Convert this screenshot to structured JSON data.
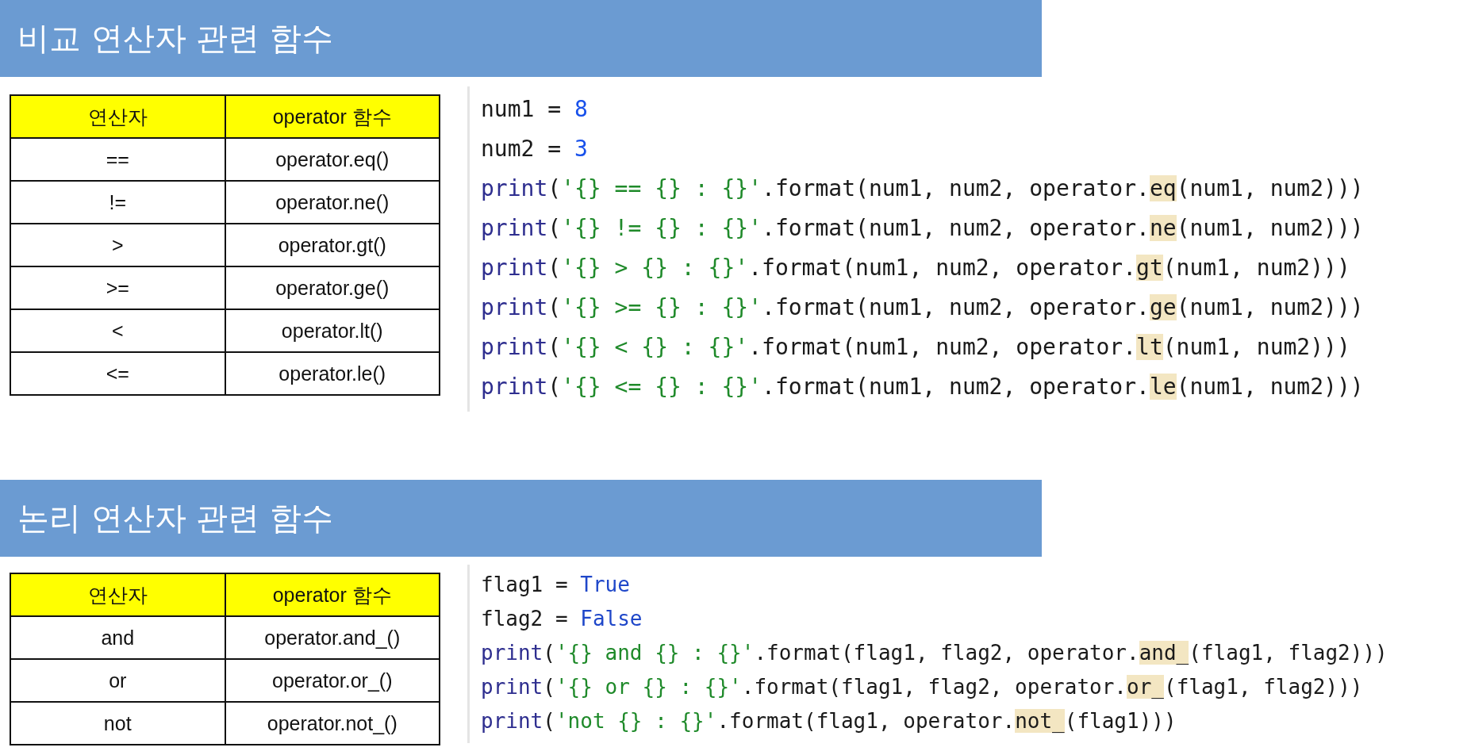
{
  "sections": [
    {
      "title": "비교 연산자 관련 함수",
      "kind": "wide",
      "table": {
        "columns": [
          "연산자",
          "operator 함수"
        ],
        "rows": [
          [
            "==",
            "operator.eq()"
          ],
          [
            "!=",
            "operator.ne()"
          ],
          [
            ">",
            "operator.gt()"
          ],
          [
            ">=",
            "operator.ge()"
          ],
          [
            "<",
            "operator.lt()"
          ],
          [
            "<=",
            "operator.le()"
          ]
        ]
      },
      "code": [
        [
          {
            "kind": "name",
            "text": "num1 = "
          },
          {
            "kind": "number",
            "text": "8"
          }
        ],
        [
          {
            "kind": "name",
            "text": "num2 = "
          },
          {
            "kind": "number",
            "text": "3"
          }
        ],
        [
          {
            "kind": "builtin",
            "text": "print"
          },
          {
            "kind": "name",
            "text": "("
          },
          {
            "kind": "string",
            "text": "'{} == {} : {}'"
          },
          {
            "kind": "name",
            "text": ".format(num1, num2, operator."
          },
          {
            "kind": "match",
            "text": "eq"
          },
          {
            "kind": "name",
            "text": "(num1, num2)))"
          }
        ],
        [
          {
            "kind": "builtin",
            "text": "print"
          },
          {
            "kind": "name",
            "text": "("
          },
          {
            "kind": "string",
            "text": "'{} != {} : {}'"
          },
          {
            "kind": "name",
            "text": ".format(num1, num2, operator."
          },
          {
            "kind": "match",
            "text": "ne"
          },
          {
            "kind": "name",
            "text": "(num1, num2)))"
          }
        ],
        [
          {
            "kind": "builtin",
            "text": "print"
          },
          {
            "kind": "name",
            "text": "("
          },
          {
            "kind": "string",
            "text": "'{} > {} : {}'"
          },
          {
            "kind": "name",
            "text": ".format(num1, num2, operator."
          },
          {
            "kind": "match",
            "text": "gt"
          },
          {
            "kind": "name",
            "text": "(num1, num2)))"
          }
        ],
        [
          {
            "kind": "builtin",
            "text": "print"
          },
          {
            "kind": "name",
            "text": "("
          },
          {
            "kind": "string",
            "text": "'{} >= {} : {}'"
          },
          {
            "kind": "name",
            "text": ".format(num1, num2, operator."
          },
          {
            "kind": "match",
            "text": "ge"
          },
          {
            "kind": "name",
            "text": "(num1, num2)))"
          }
        ],
        [
          {
            "kind": "builtin",
            "text": "print"
          },
          {
            "kind": "name",
            "text": "("
          },
          {
            "kind": "string",
            "text": "'{} < {} : {}'"
          },
          {
            "kind": "name",
            "text": ".format(num1, num2, operator."
          },
          {
            "kind": "match",
            "text": "lt"
          },
          {
            "kind": "name",
            "text": "(num1, num2)))"
          }
        ],
        [
          {
            "kind": "builtin",
            "text": "print"
          },
          {
            "kind": "name",
            "text": "("
          },
          {
            "kind": "string",
            "text": "'{} <= {} : {}'"
          },
          {
            "kind": "name",
            "text": ".format(num1, num2, operator."
          },
          {
            "kind": "match",
            "text": "le"
          },
          {
            "kind": "name",
            "text": "(num1, num2)))"
          }
        ]
      ]
    },
    {
      "title": "논리 연산자 관련 함수",
      "kind": "compact",
      "table": {
        "columns": [
          "연산자",
          "operator 함수"
        ],
        "rows": [
          [
            "and",
            "operator.and_()"
          ],
          [
            "or",
            "operator.or_()"
          ],
          [
            "not",
            "operator.not_()"
          ]
        ]
      },
      "code": [
        [
          {
            "kind": "name",
            "text": "flag1 = "
          },
          {
            "kind": "constant",
            "text": "True"
          }
        ],
        [
          {
            "kind": "name",
            "text": "flag2 = "
          },
          {
            "kind": "constant",
            "text": "False"
          }
        ],
        [
          {
            "kind": "builtin",
            "text": "print"
          },
          {
            "kind": "name",
            "text": "("
          },
          {
            "kind": "string",
            "text": "'{} and {} : {}'"
          },
          {
            "kind": "name",
            "text": ".format(flag1, flag2, operator."
          },
          {
            "kind": "match",
            "text": "and_"
          },
          {
            "kind": "name",
            "text": "(flag1, flag2)))"
          }
        ],
        [
          {
            "kind": "builtin",
            "text": "print"
          },
          {
            "kind": "name",
            "text": "("
          },
          {
            "kind": "string",
            "text": "'{} or {} : {}'"
          },
          {
            "kind": "name",
            "text": ".format(flag1, flag2, operator."
          },
          {
            "kind": "match",
            "text": "or_"
          },
          {
            "kind": "name",
            "text": "(flag1, flag2)))"
          }
        ],
        [
          {
            "kind": "builtin",
            "text": "print"
          },
          {
            "kind": "name",
            "text": "("
          },
          {
            "kind": "string",
            "text": "'not {} : {}'"
          },
          {
            "kind": "name",
            "text": ".format(flag1, operator."
          },
          {
            "kind": "match",
            "text": "not_"
          },
          {
            "kind": "name",
            "text": "(flag1)))"
          }
        ]
      ]
    }
  ]
}
